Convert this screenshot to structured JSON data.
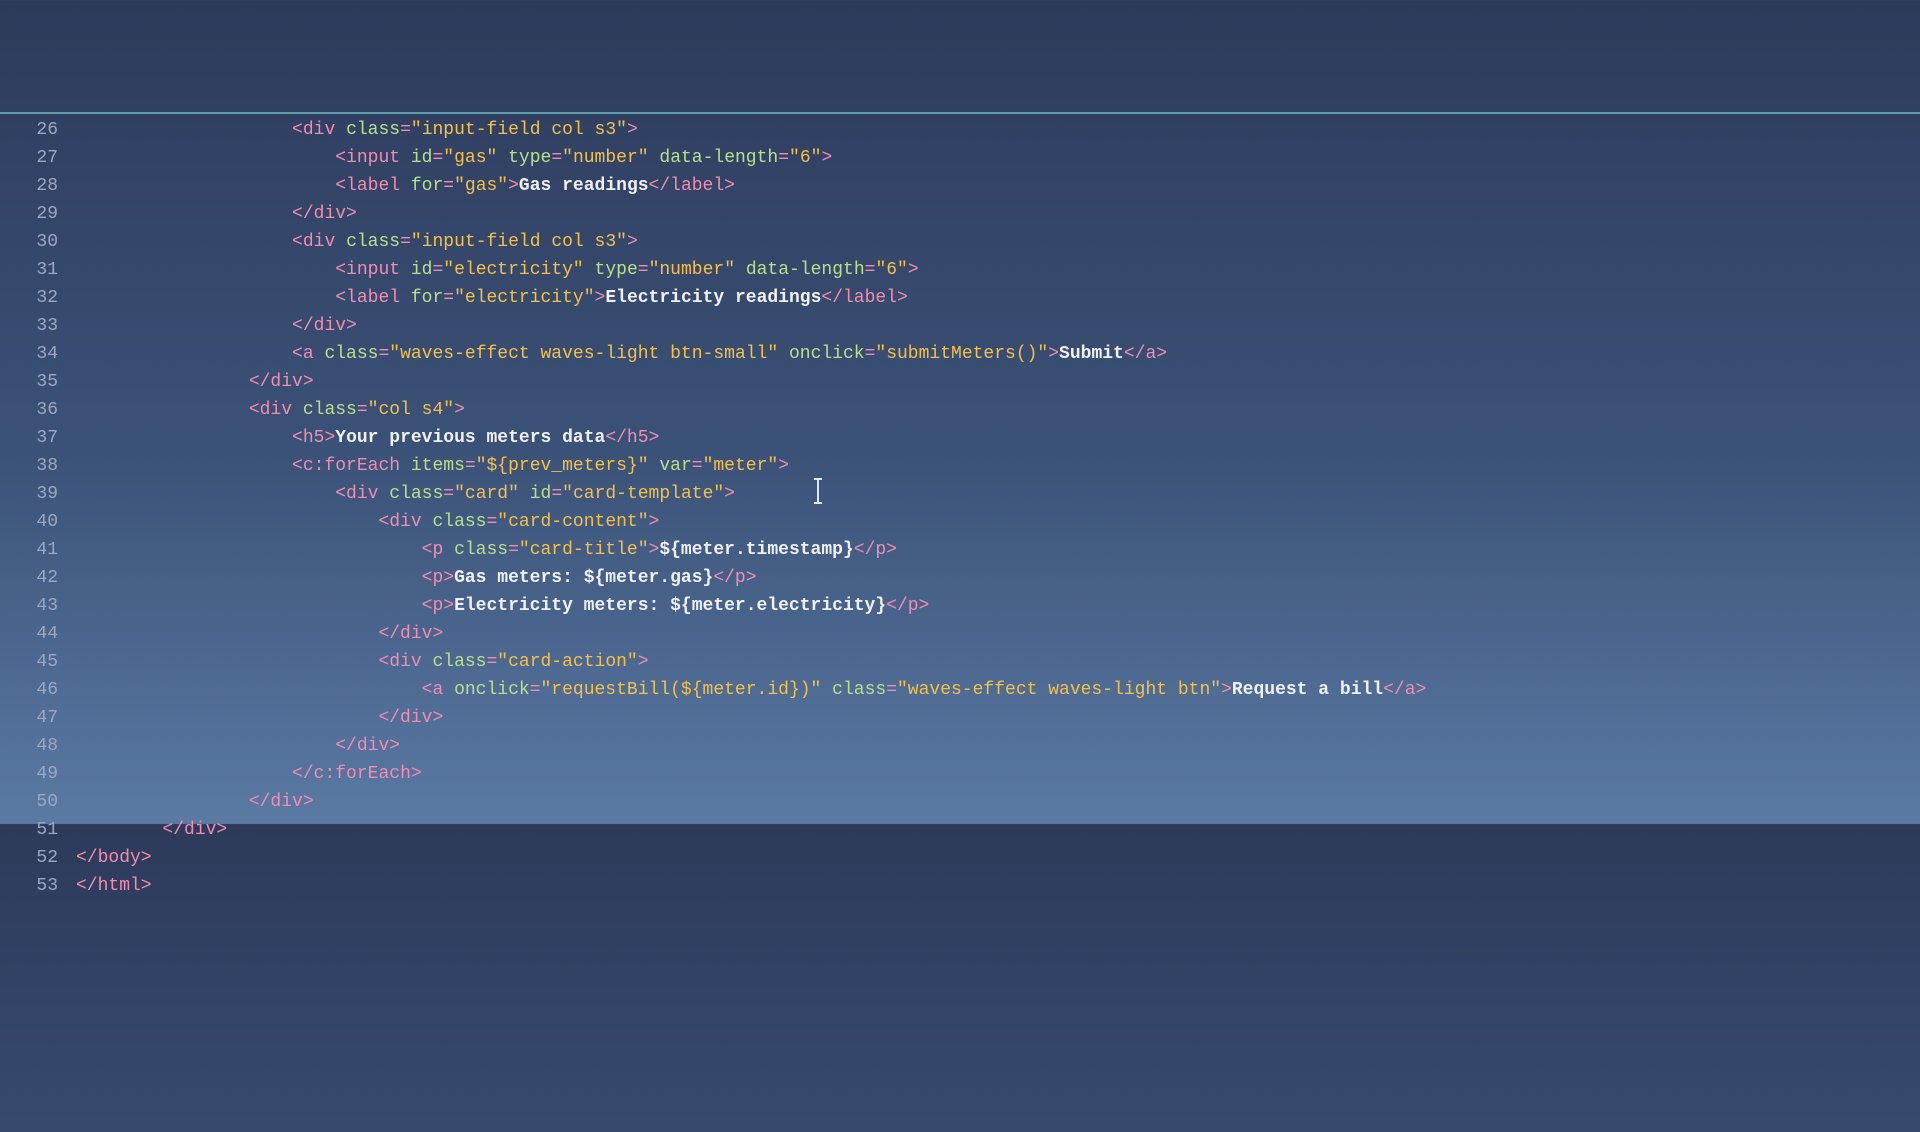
{
  "lines": [
    {
      "num": 26,
      "indent": 5,
      "tokens": [
        {
          "t": "tag",
          "v": "<div "
        },
        {
          "t": "attr",
          "v": "class"
        },
        {
          "t": "eq",
          "v": "="
        },
        {
          "t": "val",
          "v": "\"input-field col s3\""
        },
        {
          "t": "tag",
          "v": ">"
        }
      ]
    },
    {
      "num": 27,
      "indent": 6,
      "tokens": [
        {
          "t": "tag",
          "v": "<input "
        },
        {
          "t": "attr",
          "v": "id"
        },
        {
          "t": "eq",
          "v": "="
        },
        {
          "t": "val",
          "v": "\"gas\""
        },
        {
          "t": "txt",
          "v": " "
        },
        {
          "t": "attr",
          "v": "type"
        },
        {
          "t": "eq",
          "v": "="
        },
        {
          "t": "val",
          "v": "\"number\""
        },
        {
          "t": "txt",
          "v": " "
        },
        {
          "t": "attr",
          "v": "data-length"
        },
        {
          "t": "eq",
          "v": "="
        },
        {
          "t": "val",
          "v": "\"6\""
        },
        {
          "t": "tag",
          "v": ">"
        }
      ]
    },
    {
      "num": 28,
      "indent": 6,
      "tokens": [
        {
          "t": "tag",
          "v": "<label "
        },
        {
          "t": "attr",
          "v": "for"
        },
        {
          "t": "eq",
          "v": "="
        },
        {
          "t": "val",
          "v": "\"gas\""
        },
        {
          "t": "tag",
          "v": ">"
        },
        {
          "t": "txt",
          "v": "Gas readings"
        },
        {
          "t": "tag",
          "v": "</label>"
        }
      ]
    },
    {
      "num": 29,
      "indent": 5,
      "tokens": [
        {
          "t": "tag",
          "v": "</div>"
        }
      ]
    },
    {
      "num": 30,
      "indent": 5,
      "tokens": [
        {
          "t": "tag",
          "v": "<div "
        },
        {
          "t": "attr",
          "v": "class"
        },
        {
          "t": "eq",
          "v": "="
        },
        {
          "t": "val",
          "v": "\"input-field col s3\""
        },
        {
          "t": "tag",
          "v": ">"
        }
      ]
    },
    {
      "num": 31,
      "indent": 6,
      "tokens": [
        {
          "t": "tag",
          "v": "<input "
        },
        {
          "t": "attr",
          "v": "id"
        },
        {
          "t": "eq",
          "v": "="
        },
        {
          "t": "val",
          "v": "\"electricity\""
        },
        {
          "t": "txt",
          "v": " "
        },
        {
          "t": "attr",
          "v": "type"
        },
        {
          "t": "eq",
          "v": "="
        },
        {
          "t": "val",
          "v": "\"number\""
        },
        {
          "t": "txt",
          "v": " "
        },
        {
          "t": "attr",
          "v": "data-length"
        },
        {
          "t": "eq",
          "v": "="
        },
        {
          "t": "val",
          "v": "\"6\""
        },
        {
          "t": "tag",
          "v": ">"
        }
      ]
    },
    {
      "num": 32,
      "indent": 6,
      "tokens": [
        {
          "t": "tag",
          "v": "<label "
        },
        {
          "t": "attr",
          "v": "for"
        },
        {
          "t": "eq",
          "v": "="
        },
        {
          "t": "val",
          "v": "\"electricity\""
        },
        {
          "t": "tag",
          "v": ">"
        },
        {
          "t": "txt",
          "v": "Electricity readings"
        },
        {
          "t": "tag",
          "v": "</label>"
        }
      ]
    },
    {
      "num": 33,
      "indent": 5,
      "tokens": [
        {
          "t": "tag",
          "v": "</div>"
        }
      ]
    },
    {
      "num": 34,
      "indent": 5,
      "tokens": [
        {
          "t": "tag",
          "v": "<a "
        },
        {
          "t": "attr",
          "v": "class"
        },
        {
          "t": "eq",
          "v": "="
        },
        {
          "t": "val",
          "v": "\"waves-effect waves-light btn-small\""
        },
        {
          "t": "txt",
          "v": " "
        },
        {
          "t": "attr",
          "v": "onclick"
        },
        {
          "t": "eq",
          "v": "="
        },
        {
          "t": "val",
          "v": "\"submitMeters()\""
        },
        {
          "t": "tag",
          "v": ">"
        },
        {
          "t": "txt",
          "v": "Submit"
        },
        {
          "t": "tag",
          "v": "</a>"
        }
      ]
    },
    {
      "num": 35,
      "indent": 4,
      "tokens": [
        {
          "t": "tag",
          "v": "</div>"
        }
      ]
    },
    {
      "num": 36,
      "indent": 4,
      "tokens": [
        {
          "t": "tag",
          "v": "<div "
        },
        {
          "t": "attr",
          "v": "class"
        },
        {
          "t": "eq",
          "v": "="
        },
        {
          "t": "val",
          "v": "\"col s4\""
        },
        {
          "t": "tag",
          "v": ">"
        }
      ]
    },
    {
      "num": 37,
      "indent": 5,
      "tokens": [
        {
          "t": "tag",
          "v": "<h5>"
        },
        {
          "t": "txt",
          "v": "Your previous meters data"
        },
        {
          "t": "tag",
          "v": "</h5>"
        }
      ]
    },
    {
      "num": 38,
      "indent": 5,
      "tokens": [
        {
          "t": "jsp",
          "v": "<c:forEach "
        },
        {
          "t": "attr",
          "v": "items"
        },
        {
          "t": "eq",
          "v": "="
        },
        {
          "t": "val",
          "v": "\"${prev_meters}\""
        },
        {
          "t": "txt",
          "v": " "
        },
        {
          "t": "attr",
          "v": "var"
        },
        {
          "t": "eq",
          "v": "="
        },
        {
          "t": "val",
          "v": "\"meter\""
        },
        {
          "t": "jsp",
          "v": ">"
        }
      ]
    },
    {
      "num": 39,
      "indent": 6,
      "tokens": [
        {
          "t": "tag",
          "v": "<div "
        },
        {
          "t": "attr",
          "v": "class"
        },
        {
          "t": "eq",
          "v": "="
        },
        {
          "t": "val",
          "v": "\"card\""
        },
        {
          "t": "txt",
          "v": " "
        },
        {
          "t": "attr",
          "v": "id"
        },
        {
          "t": "eq",
          "v": "="
        },
        {
          "t": "val",
          "v": "\"card-template\""
        },
        {
          "t": "tag",
          "v": ">"
        }
      ]
    },
    {
      "num": 40,
      "indent": 7,
      "tokens": [
        {
          "t": "tag",
          "v": "<div "
        },
        {
          "t": "attr",
          "v": "class"
        },
        {
          "t": "eq",
          "v": "="
        },
        {
          "t": "val",
          "v": "\"card-content\""
        },
        {
          "t": "tag",
          "v": ">"
        }
      ]
    },
    {
      "num": 41,
      "indent": 8,
      "tokens": [
        {
          "t": "tag",
          "v": "<p "
        },
        {
          "t": "attr",
          "v": "class"
        },
        {
          "t": "eq",
          "v": "="
        },
        {
          "t": "val",
          "v": "\"card-title\""
        },
        {
          "t": "tag",
          "v": ">"
        },
        {
          "t": "expr",
          "v": "${meter.timestamp}"
        },
        {
          "t": "tag",
          "v": "</p>"
        }
      ]
    },
    {
      "num": 42,
      "indent": 8,
      "tokens": [
        {
          "t": "tag",
          "v": "<p>"
        },
        {
          "t": "txt",
          "v": "Gas meters: "
        },
        {
          "t": "expr",
          "v": "${meter.gas}"
        },
        {
          "t": "tag",
          "v": "</p>"
        }
      ]
    },
    {
      "num": 43,
      "indent": 8,
      "tokens": [
        {
          "t": "tag",
          "v": "<p>"
        },
        {
          "t": "txt",
          "v": "Electricity meters: "
        },
        {
          "t": "expr",
          "v": "${meter.electricity}"
        },
        {
          "t": "tag",
          "v": "</p>"
        }
      ]
    },
    {
      "num": 44,
      "indent": 7,
      "tokens": [
        {
          "t": "tag",
          "v": "</div>"
        }
      ]
    },
    {
      "num": 45,
      "indent": 7,
      "tokens": [
        {
          "t": "tag",
          "v": "<div "
        },
        {
          "t": "attr",
          "v": "class"
        },
        {
          "t": "eq",
          "v": "="
        },
        {
          "t": "val",
          "v": "\"card-action\""
        },
        {
          "t": "tag",
          "v": ">"
        }
      ]
    },
    {
      "num": 46,
      "indent": 8,
      "tokens": [
        {
          "t": "tag",
          "v": "<a "
        },
        {
          "t": "attr",
          "v": "onclick"
        },
        {
          "t": "eq",
          "v": "="
        },
        {
          "t": "val",
          "v": "\"requestBill(${meter.id})\""
        },
        {
          "t": "txt",
          "v": " "
        },
        {
          "t": "attr",
          "v": "class"
        },
        {
          "t": "eq",
          "v": "="
        },
        {
          "t": "val",
          "v": "\"waves-effect waves-light btn\""
        },
        {
          "t": "tag",
          "v": ">"
        },
        {
          "t": "txt",
          "v": "Request a bill"
        },
        {
          "t": "tag",
          "v": "</a>"
        }
      ]
    },
    {
      "num": 47,
      "indent": 7,
      "tokens": [
        {
          "t": "tag",
          "v": "</div>"
        }
      ]
    },
    {
      "num": 48,
      "indent": 6,
      "tokens": [
        {
          "t": "tag",
          "v": "</div>"
        }
      ]
    },
    {
      "num": 49,
      "indent": 5,
      "tokens": [
        {
          "t": "jsp",
          "v": "</c:forEach>"
        }
      ]
    },
    {
      "num": 50,
      "indent": 4,
      "tokens": [
        {
          "t": "tag",
          "v": "</div>"
        }
      ]
    },
    {
      "num": 51,
      "indent": 2,
      "tokens": [
        {
          "t": "tag",
          "v": "</div>"
        }
      ]
    },
    {
      "num": 52,
      "indent": 0,
      "tokens": [
        {
          "t": "tag",
          "v": "</body>"
        }
      ]
    },
    {
      "num": 53,
      "indent": 0,
      "tokens": [
        {
          "t": "tag",
          "v": "</html>"
        }
      ]
    }
  ]
}
